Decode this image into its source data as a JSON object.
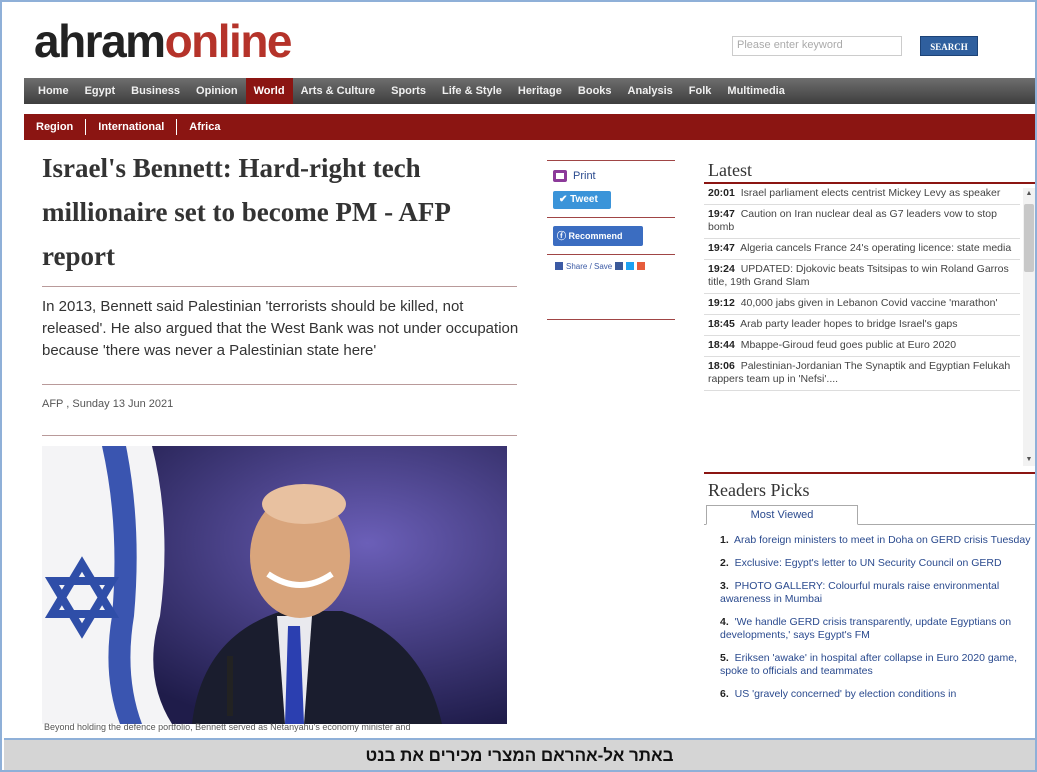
{
  "logo": {
    "part1": "ahram",
    "part2": "online"
  },
  "search": {
    "placeholder": "Please enter keyword",
    "button": "SEARCH"
  },
  "nav": {
    "items": [
      "Home",
      "Egypt",
      "Business",
      "Opinion",
      "World",
      "Arts & Culture",
      "Sports",
      "Life & Style",
      "Heritage",
      "Books",
      "Analysis",
      "Folk",
      "Multimedia"
    ],
    "active": "World"
  },
  "subnav": {
    "items": [
      "Region",
      "International",
      "Africa"
    ]
  },
  "article": {
    "headline": "Israel's Bennett: Hard-right tech millionaire set to become PM - AFP report",
    "lead": "In 2013, Bennett said Palestinian 'terrorists should be killed, not released'. He also argued that the West Bank was not under occupation because 'there was never a Palestinian state here'",
    "byline": "AFP , Sunday 13 Jun 2021",
    "caption": "Beyond holding the defence portfolio, Bennett served as Netanyahu's economy minister and"
  },
  "share": {
    "print": "Print",
    "tweet": "Tweet",
    "recommend": "Recommend",
    "share_save": "Share / Save"
  },
  "latest": {
    "title": "Latest",
    "items": [
      {
        "time": "20:01",
        "text": "Israel parliament elects centrist Mickey Levy as speaker"
      },
      {
        "time": "19:47",
        "text": "Caution on Iran nuclear deal as G7 leaders vow to stop bomb"
      },
      {
        "time": "19:47",
        "text": "Algeria cancels France 24's operating licence: state media"
      },
      {
        "time": "19:24",
        "text": "UPDATED: Djokovic beats Tsitsipas to win Roland Garros title, 19th Grand Slam"
      },
      {
        "time": "19:12",
        "text": "40,000 jabs given in Lebanon Covid vaccine 'marathon'"
      },
      {
        "time": "18:45",
        "text": "Arab party leader hopes to bridge Israel's gaps"
      },
      {
        "time": "18:44",
        "text": "Mbappe-Giroud feud goes public at Euro 2020"
      },
      {
        "time": "18:06",
        "text": "Palestinian-Jordanian The Synaptik and Egyptian Felukah rappers team up in 'Nefsi'...."
      }
    ]
  },
  "readers": {
    "title": "Readers Picks",
    "tab": "Most Viewed",
    "items": [
      {
        "num": "1.",
        "text": "Arab foreign ministers to meet in Doha on GERD crisis Tuesday"
      },
      {
        "num": "2.",
        "text": "Exclusive: Egypt's letter to UN Security Council on GERD"
      },
      {
        "num": "3.",
        "text": "PHOTO GALLERY: Colourful murals raise environmental awareness in Mumbai"
      },
      {
        "num": "4.",
        "text": "'We handle GERD crisis transparently, update Egyptians on developments,' says Egypt's FM"
      },
      {
        "num": "5.",
        "text": "Eriksen 'awake' in hospital after collapse in Euro 2020 game, spoke to officials and teammates"
      },
      {
        "num": "6.",
        "text": "US 'gravely concerned' by election conditions in"
      }
    ]
  },
  "bottom_caption": "באתר אל-אהראם המצרי מכירים את בנט",
  "colors": {
    "brand_red": "#8b1512",
    "logo_red": "#b5332a",
    "nav_gray": "#4a4a4a",
    "link_blue": "#2a4a8e"
  }
}
